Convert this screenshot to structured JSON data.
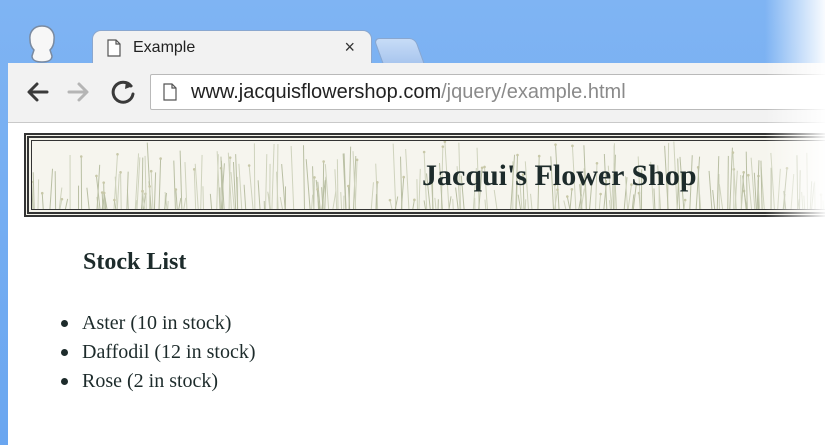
{
  "browser": {
    "tab": {
      "title": "Example",
      "close_glyph": "×"
    },
    "address_bar": {
      "url_host": "www.jacquisflowershop.com",
      "url_path": "/jquery/example.html"
    },
    "icons": {
      "back": "back-arrow-icon",
      "forward": "forward-arrow-icon",
      "reload": "reload-icon",
      "page": "page-icon",
      "profile": "profile-avatar-icon"
    },
    "colors": {
      "frame": "#6aa6f0",
      "toolbar": "#f2f2f2"
    }
  },
  "page": {
    "banner_title": "Jacqui's Flower Shop",
    "stock_heading": "Stock List",
    "stock_items": [
      "Aster (10 in stock)",
      "Daffodil (12 in stock)",
      "Rose (2 in stock)"
    ]
  }
}
